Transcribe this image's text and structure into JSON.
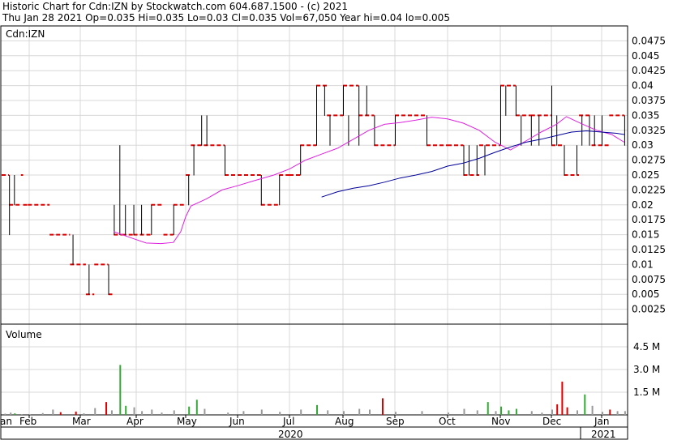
{
  "header": {
    "line1": "Historic Chart for Cdn:IZN by Stockwatch.com 604.687.1500 - (c) 2021",
    "line2": "Thu Jan 28 2021   Op=0.035   Hi=0.035   Lo=0.03   Cl=0.035   Vol=67,050   Year hi=0.04   lo=0.005"
  },
  "colors": {
    "price_bar": "#000000",
    "price_tick": "#dd0000",
    "ma_short": "#dd22dd",
    "ma_long": "#000099",
    "vol_up": "#33aa33",
    "vol_down": "#dd0000",
    "vol_flat": "#999999",
    "grid": "#d8d8d8",
    "frame": "#000000"
  },
  "chart_data": [
    {
      "type": "line",
      "title": "Cdn:IZN",
      "ylim": [
        0,
        0.05
      ],
      "y_ticks": [
        "0.0025",
        "0.005",
        "0.0075",
        "0.01",
        "0.0125",
        "0.015",
        "0.0175",
        "0.02",
        "0.0225",
        "0.025",
        "0.0275",
        "0.03",
        "0.0325",
        "0.035",
        "0.0375",
        "0.04",
        "0.0425",
        "0.045",
        "0.0475"
      ],
      "x_labels": [
        "an",
        "Feb",
        "Mar",
        "Apr",
        "May",
        "Jun",
        "Jul",
        "Aug",
        "Sep",
        "Oct",
        "Nov",
        "Dec",
        "Jan"
      ],
      "year_labels": [
        "2020",
        "2021"
      ],
      "grid": true,
      "price_steps": [
        {
          "x0": 0.0,
          "x1": 0.27,
          "y": 0.025
        },
        {
          "x0": 0.27,
          "x1": 0.7,
          "y": 0.02
        },
        {
          "x0": 0.7,
          "x1": 0.78,
          "y": 0.025
        },
        {
          "x0": 0.78,
          "x1": 0.95,
          "y": 0.02
        },
        {
          "x0": 0.95,
          "x1": 1.4,
          "y": 0.02
        },
        {
          "x0": 1.4,
          "x1": 1.8,
          "y": 0.015
        },
        {
          "x0": 1.8,
          "x1": 2.1,
          "y": 0.01
        },
        {
          "x0": 2.1,
          "x1": 2.25,
          "y": 0.005
        },
        {
          "x0": 2.25,
          "x1": 2.5,
          "y": 0.01
        },
        {
          "x0": 2.5,
          "x1": 2.6,
          "y": 0.005
        },
        {
          "x0": 2.6,
          "x1": 2.75,
          "y": 0.015
        },
        {
          "x0": 2.75,
          "x1": 2.95,
          "y": 0.015
        },
        {
          "x0": 2.95,
          "x1": 3.3,
          "y": 0.015
        },
        {
          "x0": 3.3,
          "x1": 3.55,
          "y": 0.02
        },
        {
          "x0": 3.55,
          "x1": 3.75,
          "y": 0.015
        },
        {
          "x0": 3.75,
          "x1": 4.0,
          "y": 0.02
        },
        {
          "x0": 4.0,
          "x1": 4.1,
          "y": 0.025
        },
        {
          "x0": 4.1,
          "x1": 4.35,
          "y": 0.03
        },
        {
          "x0": 4.35,
          "x1": 4.6,
          "y": 0.03
        },
        {
          "x0": 4.6,
          "x1": 4.75,
          "y": 0.03
        },
        {
          "x0": 4.75,
          "x1": 5.0,
          "y": 0.025
        },
        {
          "x0": 5.0,
          "x1": 5.45,
          "y": 0.025
        },
        {
          "x0": 5.45,
          "x1": 5.8,
          "y": 0.02
        },
        {
          "x0": 5.8,
          "x1": 6.0,
          "y": 0.025
        },
        {
          "x0": 6.0,
          "x1": 6.2,
          "y": 0.025
        },
        {
          "x0": 6.2,
          "x1": 6.5,
          "y": 0.03
        },
        {
          "x0": 6.5,
          "x1": 6.7,
          "y": 0.04
        },
        {
          "x0": 6.7,
          "x1": 7.0,
          "y": 0.035
        },
        {
          "x0": 7.0,
          "x1": 7.3,
          "y": 0.04
        },
        {
          "x0": 7.3,
          "x1": 7.6,
          "y": 0.035
        },
        {
          "x0": 7.6,
          "x1": 8.0,
          "y": 0.03
        },
        {
          "x0": 8.0,
          "x1": 8.6,
          "y": 0.035
        },
        {
          "x0": 8.6,
          "x1": 9.0,
          "y": 0.03
        },
        {
          "x0": 9.0,
          "x1": 9.3,
          "y": 0.03
        },
        {
          "x0": 9.3,
          "x1": 9.6,
          "y": 0.025
        },
        {
          "x0": 9.6,
          "x1": 10.0,
          "y": 0.03
        },
        {
          "x0": 10.0,
          "x1": 10.3,
          "y": 0.04
        },
        {
          "x0": 10.3,
          "x1": 10.6,
          "y": 0.035
        },
        {
          "x0": 10.6,
          "x1": 11.0,
          "y": 0.035
        },
        {
          "x0": 11.0,
          "x1": 11.25,
          "y": 0.03
        },
        {
          "x0": 11.25,
          "x1": 11.55,
          "y": 0.025
        },
        {
          "x0": 11.55,
          "x1": 11.8,
          "y": 0.035
        },
        {
          "x0": 11.8,
          "x1": 12.15,
          "y": 0.03
        },
        {
          "x0": 12.15,
          "x1": 12.45,
          "y": 0.035
        }
      ],
      "price_bars": [
        {
          "x": 0.27,
          "lo": 0.015,
          "hi": 0.025
        },
        {
          "x": 0.45,
          "lo": 0.02,
          "hi": 0.025
        },
        {
          "x": 1.5,
          "lo": 0.015,
          "hi": 0.015
        },
        {
          "x": 1.85,
          "lo": 0.01,
          "hi": 0.015
        },
        {
          "x": 2.15,
          "lo": 0.005,
          "hi": 0.01
        },
        {
          "x": 2.5,
          "lo": 0.005,
          "hi": 0.01
        },
        {
          "x": 2.6,
          "lo": 0.015,
          "hi": 0.02
        },
        {
          "x": 2.7,
          "lo": 0.015,
          "hi": 0.03
        },
        {
          "x": 2.8,
          "lo": 0.015,
          "hi": 0.02
        },
        {
          "x": 2.95,
          "lo": 0.015,
          "hi": 0.02
        },
        {
          "x": 3.1,
          "lo": 0.015,
          "hi": 0.02
        },
        {
          "x": 3.3,
          "lo": 0.015,
          "hi": 0.02
        },
        {
          "x": 3.75,
          "lo": 0.015,
          "hi": 0.02
        },
        {
          "x": 4.05,
          "lo": 0.02,
          "hi": 0.025
        },
        {
          "x": 4.15,
          "lo": 0.025,
          "hi": 0.03
        },
        {
          "x": 4.3,
          "lo": 0.03,
          "hi": 0.035
        },
        {
          "x": 4.4,
          "lo": 0.03,
          "hi": 0.035
        },
        {
          "x": 4.75,
          "lo": 0.025,
          "hi": 0.03
        },
        {
          "x": 5.45,
          "lo": 0.02,
          "hi": 0.025
        },
        {
          "x": 5.8,
          "lo": 0.02,
          "hi": 0.025
        },
        {
          "x": 6.2,
          "lo": 0.025,
          "hi": 0.03
        },
        {
          "x": 6.5,
          "lo": 0.03,
          "hi": 0.04
        },
        {
          "x": 6.65,
          "lo": 0.035,
          "hi": 0.04
        },
        {
          "x": 6.75,
          "lo": 0.03,
          "hi": 0.035
        },
        {
          "x": 7.0,
          "lo": 0.035,
          "hi": 0.04
        },
        {
          "x": 7.1,
          "lo": 0.03,
          "hi": 0.035
        },
        {
          "x": 7.3,
          "lo": 0.03,
          "hi": 0.04
        },
        {
          "x": 7.45,
          "lo": 0.035,
          "hi": 0.04
        },
        {
          "x": 7.6,
          "lo": 0.03,
          "hi": 0.035
        },
        {
          "x": 8.0,
          "lo": 0.03,
          "hi": 0.035
        },
        {
          "x": 8.6,
          "lo": 0.03,
          "hi": 0.035
        },
        {
          "x": 9.3,
          "lo": 0.025,
          "hi": 0.03
        },
        {
          "x": 9.4,
          "lo": 0.025,
          "hi": 0.03
        },
        {
          "x": 9.55,
          "lo": 0.025,
          "hi": 0.03
        },
        {
          "x": 9.7,
          "lo": 0.025,
          "hi": 0.03
        },
        {
          "x": 10.0,
          "lo": 0.03,
          "hi": 0.04
        },
        {
          "x": 10.1,
          "lo": 0.035,
          "hi": 0.04
        },
        {
          "x": 10.3,
          "lo": 0.035,
          "hi": 0.04
        },
        {
          "x": 10.4,
          "lo": 0.03,
          "hi": 0.035
        },
        {
          "x": 10.6,
          "lo": 0.03,
          "hi": 0.035
        },
        {
          "x": 10.75,
          "lo": 0.03,
          "hi": 0.035
        },
        {
          "x": 11.0,
          "lo": 0.03,
          "hi": 0.04
        },
        {
          "x": 11.1,
          "lo": 0.03,
          "hi": 0.035
        },
        {
          "x": 11.25,
          "lo": 0.025,
          "hi": 0.03
        },
        {
          "x": 11.5,
          "lo": 0.025,
          "hi": 0.03
        },
        {
          "x": 11.6,
          "lo": 0.03,
          "hi": 0.035
        },
        {
          "x": 11.75,
          "lo": 0.03,
          "hi": 0.035
        },
        {
          "x": 11.85,
          "lo": 0.03,
          "hi": 0.035
        },
        {
          "x": 12.0,
          "lo": 0.03,
          "hi": 0.035
        },
        {
          "x": 12.45,
          "lo": 0.03,
          "hi": 0.035
        }
      ],
      "ma_short": [
        [
          2.6,
          0.0155
        ],
        [
          2.9,
          0.0145
        ],
        [
          3.2,
          0.0136
        ],
        [
          3.5,
          0.0135
        ],
        [
          3.75,
          0.0137
        ],
        [
          3.9,
          0.0155
        ],
        [
          4.0,
          0.018
        ],
        [
          4.1,
          0.0198
        ],
        [
          4.4,
          0.021
        ],
        [
          4.7,
          0.0225
        ],
        [
          5.0,
          0.0232
        ],
        [
          5.3,
          0.024
        ],
        [
          5.7,
          0.025
        ],
        [
          6.0,
          0.026
        ],
        [
          6.3,
          0.0275
        ],
        [
          6.6,
          0.0285
        ],
        [
          6.9,
          0.0295
        ],
        [
          7.2,
          0.031
        ],
        [
          7.5,
          0.0325
        ],
        [
          7.8,
          0.0335
        ],
        [
          8.1,
          0.0338
        ],
        [
          8.4,
          0.0342
        ],
        [
          8.7,
          0.0347
        ],
        [
          9.0,
          0.0344
        ],
        [
          9.3,
          0.0337
        ],
        [
          9.6,
          0.0325
        ],
        [
          9.9,
          0.0305
        ],
        [
          10.2,
          0.0292
        ],
        [
          10.5,
          0.0307
        ],
        [
          10.8,
          0.0322
        ],
        [
          11.1,
          0.0335
        ],
        [
          11.3,
          0.0348
        ],
        [
          11.6,
          0.0336
        ],
        [
          11.9,
          0.0325
        ],
        [
          12.2,
          0.0318
        ],
        [
          12.45,
          0.0305
        ]
      ],
      "ma_long": [
        [
          6.6,
          0.0213
        ],
        [
          6.9,
          0.0222
        ],
        [
          7.2,
          0.0228
        ],
        [
          7.5,
          0.0232
        ],
        [
          7.8,
          0.0238
        ],
        [
          8.1,
          0.0245
        ],
        [
          8.4,
          0.025
        ],
        [
          8.7,
          0.0256
        ],
        [
          9.0,
          0.0265
        ],
        [
          9.3,
          0.027
        ],
        [
          9.6,
          0.0278
        ],
        [
          9.9,
          0.0288
        ],
        [
          10.2,
          0.0297
        ],
        [
          10.5,
          0.0305
        ],
        [
          10.8,
          0.031
        ],
        [
          11.1,
          0.0316
        ],
        [
          11.4,
          0.0322
        ],
        [
          11.7,
          0.0324
        ],
        [
          12.0,
          0.0322
        ],
        [
          12.3,
          0.032
        ],
        [
          12.45,
          0.0318
        ]
      ]
    },
    {
      "type": "bar",
      "title": "Volume",
      "ylim": [
        0,
        6.0
      ],
      "y_ticks": [
        "1.5 M",
        "3.0 M",
        "4.5 M"
      ],
      "bars": [
        {
          "x": 0.1,
          "v": 0.08,
          "c": "flat"
        },
        {
          "x": 0.3,
          "v": 0.15,
          "c": "flat"
        },
        {
          "x": 0.45,
          "v": 0.1,
          "c": "up"
        },
        {
          "x": 0.7,
          "v": 0.05,
          "c": "flat"
        },
        {
          "x": 1.0,
          "v": 0.05,
          "c": "flat"
        },
        {
          "x": 1.25,
          "v": 0.12,
          "c": "flat"
        },
        {
          "x": 1.45,
          "v": 0.35,
          "c": "flat"
        },
        {
          "x": 1.6,
          "v": 0.18,
          "c": "down"
        },
        {
          "x": 1.9,
          "v": 0.22,
          "c": "down"
        },
        {
          "x": 2.05,
          "v": 0.1,
          "c": "flat"
        },
        {
          "x": 2.25,
          "v": 0.45,
          "c": "flat"
        },
        {
          "x": 2.45,
          "v": 0.85,
          "c": "down"
        },
        {
          "x": 2.55,
          "v": 0.3,
          "c": "flat"
        },
        {
          "x": 2.7,
          "v": 3.3,
          "c": "up"
        },
        {
          "x": 2.8,
          "v": 0.6,
          "c": "up"
        },
        {
          "x": 2.95,
          "v": 0.5,
          "c": "flat"
        },
        {
          "x": 3.1,
          "v": 0.25,
          "c": "flat"
        },
        {
          "x": 3.3,
          "v": 0.35,
          "c": "flat"
        },
        {
          "x": 3.5,
          "v": 0.15,
          "c": "flat"
        },
        {
          "x": 3.75,
          "v": 0.3,
          "c": "flat"
        },
        {
          "x": 4.05,
          "v": 0.55,
          "c": "up"
        },
        {
          "x": 4.2,
          "v": 1.0,
          "c": "up"
        },
        {
          "x": 4.35,
          "v": 0.4,
          "c": "flat"
        },
        {
          "x": 4.8,
          "v": 0.15,
          "c": "flat"
        },
        {
          "x": 5.1,
          "v": 0.25,
          "c": "flat"
        },
        {
          "x": 5.45,
          "v": 0.35,
          "c": "flat"
        },
        {
          "x": 5.8,
          "v": 0.2,
          "c": "flat"
        },
        {
          "x": 6.2,
          "v": 0.35,
          "c": "flat"
        },
        {
          "x": 6.5,
          "v": 0.65,
          "c": "up"
        },
        {
          "x": 6.7,
          "v": 0.3,
          "c": "flat"
        },
        {
          "x": 7.0,
          "v": 0.25,
          "c": "flat"
        },
        {
          "x": 7.3,
          "v": 0.4,
          "c": "flat"
        },
        {
          "x": 7.5,
          "v": 0.35,
          "c": "flat"
        },
        {
          "x": 7.75,
          "v": 1.1,
          "c": "down"
        },
        {
          "x": 8.0,
          "v": 0.2,
          "c": "flat"
        },
        {
          "x": 8.5,
          "v": 0.25,
          "c": "flat"
        },
        {
          "x": 9.0,
          "v": 0.15,
          "c": "flat"
        },
        {
          "x": 9.3,
          "v": 0.4,
          "c": "flat"
        },
        {
          "x": 9.55,
          "v": 0.3,
          "c": "flat"
        },
        {
          "x": 9.75,
          "v": 0.85,
          "c": "up"
        },
        {
          "x": 9.9,
          "v": 0.25,
          "c": "flat"
        },
        {
          "x": 10.0,
          "v": 0.55,
          "c": "up"
        },
        {
          "x": 10.15,
          "v": 0.3,
          "c": "up"
        },
        {
          "x": 10.3,
          "v": 0.4,
          "c": "up"
        },
        {
          "x": 10.6,
          "v": 0.25,
          "c": "flat"
        },
        {
          "x": 10.8,
          "v": 0.15,
          "c": "flat"
        },
        {
          "x": 11.0,
          "v": 0.35,
          "c": "flat"
        },
        {
          "x": 11.1,
          "v": 0.7,
          "c": "down"
        },
        {
          "x": 11.2,
          "v": 2.2,
          "c": "down"
        },
        {
          "x": 11.3,
          "v": 0.5,
          "c": "down"
        },
        {
          "x": 11.5,
          "v": 0.3,
          "c": "flat"
        },
        {
          "x": 11.65,
          "v": 1.35,
          "c": "up"
        },
        {
          "x": 11.8,
          "v": 0.6,
          "c": "flat"
        },
        {
          "x": 12.0,
          "v": 0.2,
          "c": "flat"
        },
        {
          "x": 12.15,
          "v": 0.35,
          "c": "down"
        },
        {
          "x": 12.3,
          "v": 0.25,
          "c": "flat"
        },
        {
          "x": 12.45,
          "v": 0.25,
          "c": "flat"
        }
      ]
    }
  ]
}
